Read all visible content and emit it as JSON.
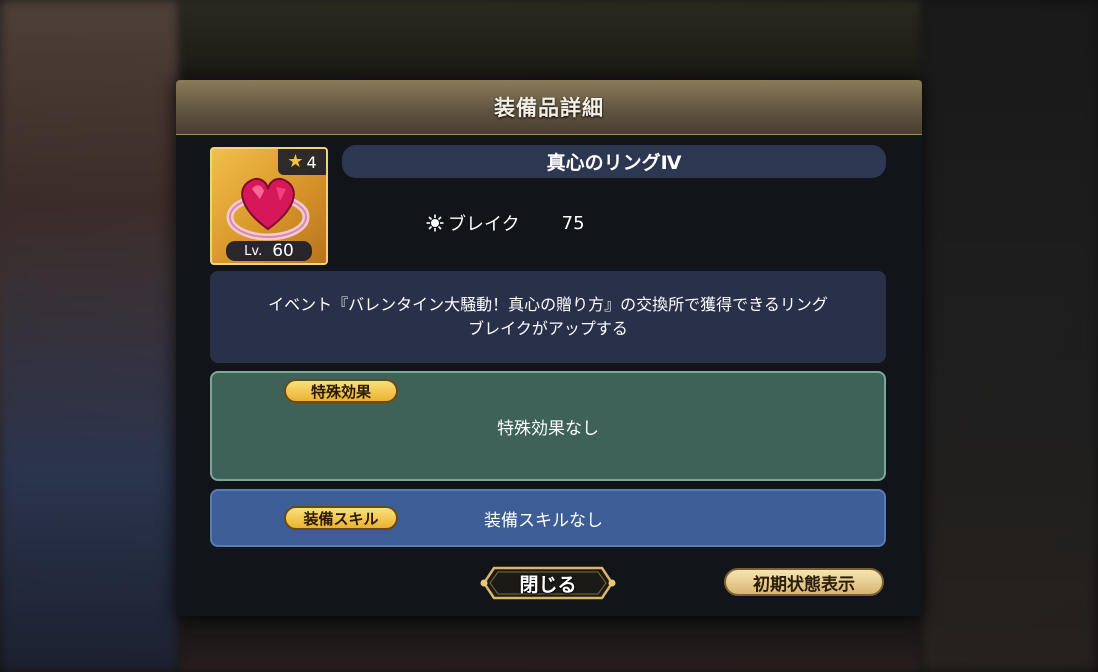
{
  "dialog": {
    "title": "装備品詳細"
  },
  "item": {
    "rarity": "4",
    "level_prefix": "Lv.",
    "level": "60",
    "name": "真心のリングⅣ",
    "icon": "heart-ring-icon",
    "stat": {
      "icon": "break-icon",
      "label": "ブレイク",
      "value": "75"
    },
    "description": {
      "line1": "イベント『バレンタイン大騒動！真心の贈り方』の交換所で獲得できるリング",
      "line2": "ブレイクがアップする"
    }
  },
  "special_effect": {
    "tag": "特殊効果",
    "value": "特殊効果なし"
  },
  "equip_skill": {
    "tag": "装備スキル",
    "value": "装備スキルなし"
  },
  "buttons": {
    "close": "閉じる",
    "reset_view": "初期状態表示"
  },
  "colors": {
    "header_gold": "#8a7b58",
    "special_green": "#3e6158",
    "skill_blue": "#3c5d95",
    "tag_gold": "#e9b231"
  }
}
